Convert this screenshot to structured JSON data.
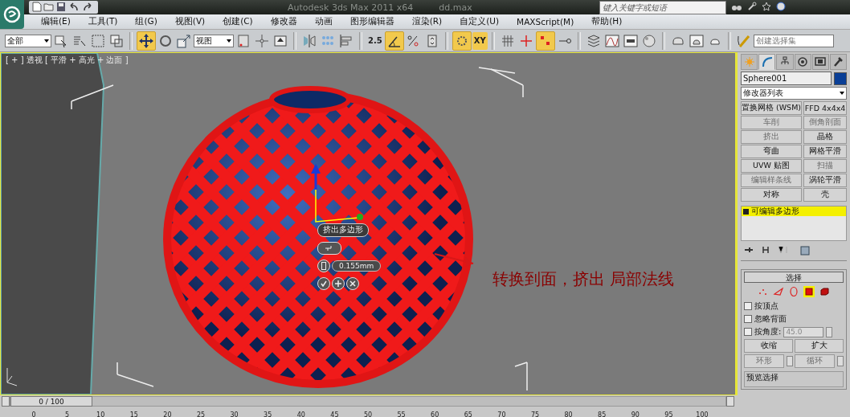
{
  "title_bar": {
    "title": "Autodesk 3ds Max  2011 x64",
    "file": "dd.max",
    "search": {
      "placeholder": "键入关键字或短语"
    }
  },
  "menu": [
    "编辑(E)",
    "工具(T)",
    "组(G)",
    "视图(V)",
    "创建(C)",
    "修改器",
    "动画",
    "图形编辑器",
    "渲染(R)",
    "自定义(U)",
    "MAXScript(M)",
    "帮助(H)"
  ],
  "toolbar": {
    "selection_filter": "全部",
    "reference_coord": "视图",
    "snap_value": "2.5",
    "constraint": "XY",
    "named_selection": {
      "placeholder": "创建选择集"
    }
  },
  "viewport": {
    "label": "[ + ] 透视 [ 平滑 + 高光 + 边面 ]",
    "caddy": {
      "title": "挤出多边形",
      "value": "0.155mm"
    },
    "annotation": "转换到面，挤出  局部法线"
  },
  "command_panel": {
    "tabs": [
      {
        "kind": "create",
        "selected": false
      },
      {
        "kind": "modify",
        "selected": true
      },
      {
        "kind": "hierarchy",
        "selected": false
      },
      {
        "kind": "motion",
        "selected": false
      },
      {
        "kind": "display",
        "selected": false
      },
      {
        "kind": "utilities",
        "selected": false
      }
    ],
    "object_name": "Sphere001",
    "modifier_list": "修改器列表",
    "modifier_buttons": [
      {
        "label": "置换网格 (WSM)",
        "disabled": false
      },
      {
        "label": "FFD 4x4x4",
        "disabled": false
      },
      {
        "label": "车削",
        "disabled": true
      },
      {
        "label": "倒角剖面",
        "disabled": true
      },
      {
        "label": "挤出",
        "disabled": true
      },
      {
        "label": "晶格",
        "disabled": false
      },
      {
        "label": "弯曲",
        "disabled": false
      },
      {
        "label": "网格平滑",
        "disabled": false
      },
      {
        "label": "UVW 贴图",
        "disabled": false
      },
      {
        "label": "扫描",
        "disabled": true
      },
      {
        "label": "编辑样条线",
        "disabled": true
      },
      {
        "label": "涡轮平滑",
        "disabled": false
      },
      {
        "label": "对称",
        "disabled": false
      },
      {
        "label": "壳",
        "disabled": false
      }
    ],
    "stack": [
      {
        "label": "可编辑多边形",
        "selected": true
      }
    ],
    "selection": {
      "title": "选择",
      "levels": [
        {
          "kind": "vertex",
          "selected": false
        },
        {
          "kind": "edge",
          "selected": false
        },
        {
          "kind": "border",
          "selected": false
        },
        {
          "kind": "polygon",
          "selected": true
        },
        {
          "kind": "element",
          "selected": false
        }
      ],
      "options": [
        {
          "label": "按顶点",
          "checked": false
        },
        {
          "label": "忽略背面",
          "checked": false
        },
        {
          "label": "按角度:",
          "checked": false
        }
      ],
      "angle": "45.0",
      "buttons": [
        {
          "label": "收缩",
          "disabled": false
        },
        {
          "label": "扩大",
          "disabled": false
        }
      ],
      "spin_buttons": [
        {
          "label": "环形",
          "disabled": true
        },
        {
          "label": "循环",
          "disabled": true
        }
      ],
      "preview_title": "预览选择"
    }
  },
  "timeline": {
    "frame": "0 / 100",
    "level": 0,
    "ticks": [
      "0",
      "5",
      "10",
      "15",
      "20",
      "25",
      "30",
      "35",
      "40",
      "45",
      "50",
      "55",
      "60",
      "65",
      "70",
      "75",
      "80",
      "85",
      "90",
      "95",
      "100"
    ]
  }
}
